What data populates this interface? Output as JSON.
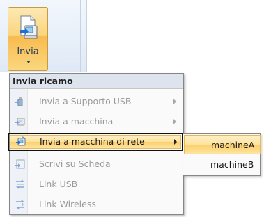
{
  "ribbon": {
    "send_button": {
      "label": "Invia",
      "icon": "send-to-machine-icon"
    }
  },
  "menu": {
    "header": "Invia ricamo",
    "items": [
      {
        "label": "Invia a Supporto USB",
        "icon": "usb-drive-icon",
        "has_submenu": true,
        "enabled": false
      },
      {
        "label": "Invia a macchina",
        "icon": "sewing-machine-icon",
        "has_submenu": true,
        "enabled": false
      },
      {
        "label": "Invia a macchina di rete",
        "icon": "network-machine-icon",
        "has_submenu": true,
        "enabled": true,
        "highlighted": true
      },
      {
        "label": "Scrivi su Scheda",
        "icon": "card-write-icon",
        "has_submenu": false,
        "enabled": false
      },
      {
        "label": "Link USB",
        "icon": "usb-link-icon",
        "has_submenu": false,
        "enabled": false
      },
      {
        "label": "Link Wireless",
        "icon": "wireless-link-icon",
        "has_submenu": false,
        "enabled": false
      }
    ]
  },
  "submenu": {
    "items": [
      {
        "label": "machineA",
        "highlighted": true
      },
      {
        "label": "machineB",
        "highlighted": false
      }
    ]
  }
}
